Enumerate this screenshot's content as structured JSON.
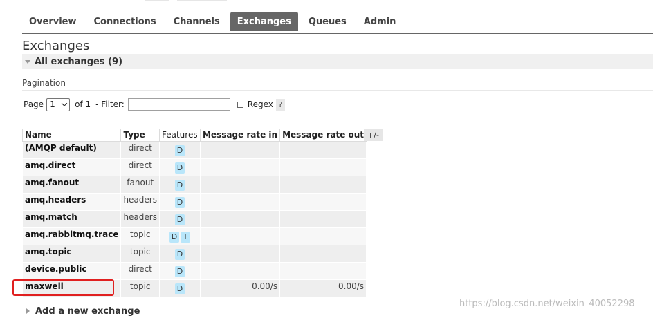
{
  "nav": {
    "items": [
      {
        "label": "Overview",
        "active": false
      },
      {
        "label": "Connections",
        "active": false
      },
      {
        "label": "Channels",
        "active": false
      },
      {
        "label": "Exchanges",
        "active": true
      },
      {
        "label": "Queues",
        "active": false
      },
      {
        "label": "Admin",
        "active": false
      }
    ]
  },
  "page": {
    "title": "Exchanges",
    "section_label": "All exchanges (9)"
  },
  "pagination": {
    "title": "Pagination",
    "page_label": "Page",
    "page_value": "1",
    "of_label": "of 1",
    "filter_label": "- Filter:",
    "filter_value": "",
    "regex_label": "Regex",
    "regex_checked": false,
    "help_label": "?"
  },
  "table": {
    "columns": [
      "Name",
      "Type",
      "Features",
      "Message rate in",
      "Message rate out"
    ],
    "toggle_label": "+/-",
    "rows": [
      {
        "name": "(AMQP default)",
        "type": "direct",
        "features": [
          "D"
        ],
        "rate_in": "",
        "rate_out": ""
      },
      {
        "name": "amq.direct",
        "type": "direct",
        "features": [
          "D"
        ],
        "rate_in": "",
        "rate_out": ""
      },
      {
        "name": "amq.fanout",
        "type": "fanout",
        "features": [
          "D"
        ],
        "rate_in": "",
        "rate_out": ""
      },
      {
        "name": "amq.headers",
        "type": "headers",
        "features": [
          "D"
        ],
        "rate_in": "",
        "rate_out": ""
      },
      {
        "name": "amq.match",
        "type": "headers",
        "features": [
          "D"
        ],
        "rate_in": "",
        "rate_out": ""
      },
      {
        "name": "amq.rabbitmq.trace",
        "type": "topic",
        "features": [
          "D",
          "I"
        ],
        "rate_in": "",
        "rate_out": ""
      },
      {
        "name": "amq.topic",
        "type": "topic",
        "features": [
          "D"
        ],
        "rate_in": "",
        "rate_out": ""
      },
      {
        "name": "device.public",
        "type": "direct",
        "features": [
          "D"
        ],
        "rate_in": "",
        "rate_out": ""
      },
      {
        "name": "maxwell",
        "type": "topic",
        "features": [
          "D"
        ],
        "rate_in": "0.00/s",
        "rate_out": "0.00/s"
      }
    ]
  },
  "add_exchange": {
    "label": "Add a new exchange"
  },
  "watermark": "https://blog.csdn.net/weixin_40052298",
  "colors": {
    "nav_active_bg": "#666666",
    "badge_bg": "#b9e6fa",
    "highlight": "#e02020"
  }
}
